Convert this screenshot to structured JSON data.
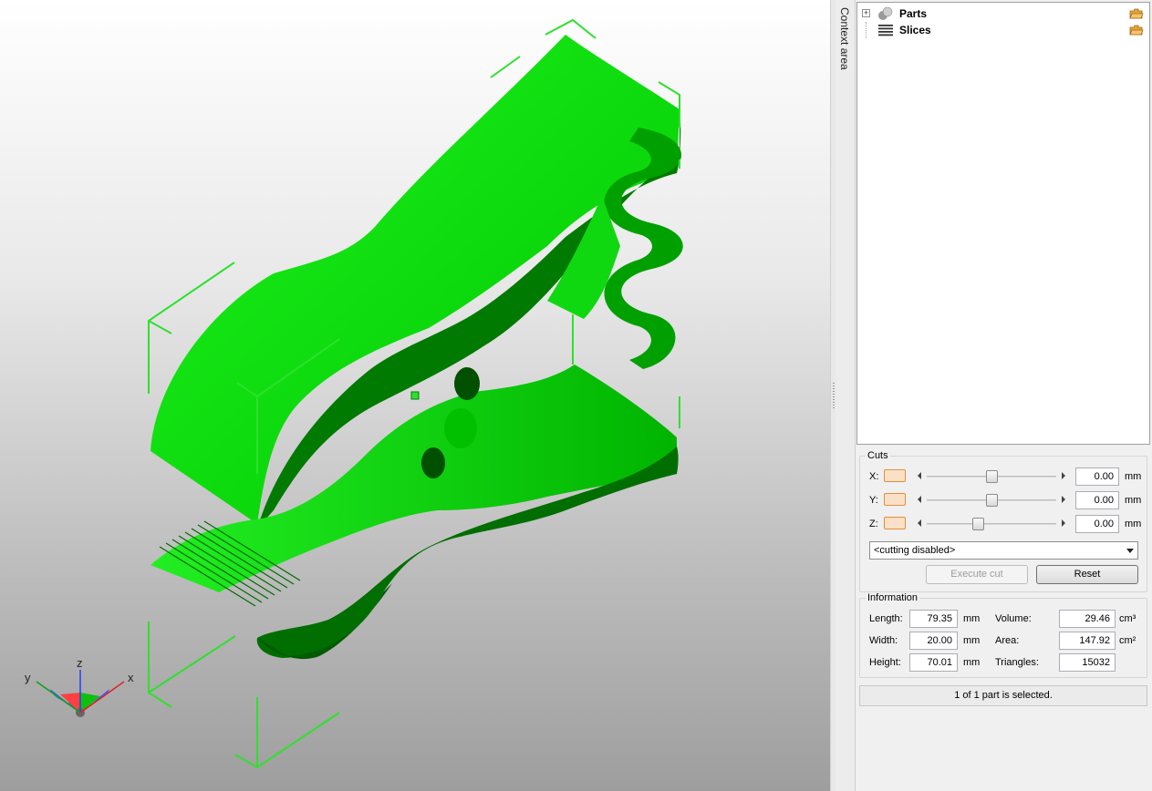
{
  "viewport": {
    "model_color": "#00d800",
    "model_shadow_color": "#006400",
    "bbox_color": "#2ee02e",
    "axes": {
      "x": "x",
      "y": "y",
      "z": "z"
    }
  },
  "sidebar": {
    "context_tab": "Context area"
  },
  "tree": {
    "items": [
      {
        "label": "Parts",
        "icon": "parts-icon"
      },
      {
        "label": "Slices",
        "icon": "slices-icon"
      }
    ]
  },
  "cuts": {
    "title": "Cuts",
    "rows": [
      {
        "axis": "X:",
        "value": "0.00",
        "unit": "mm",
        "slider_fraction": 0.5
      },
      {
        "axis": "Y:",
        "value": "0.00",
        "unit": "mm",
        "slider_fraction": 0.5
      },
      {
        "axis": "Z:",
        "value": "0.00",
        "unit": "mm",
        "slider_fraction": 0.39
      }
    ],
    "mode": "<cutting disabled>",
    "execute_label": "Execute cut",
    "reset_label": "Reset"
  },
  "information": {
    "title": "Information",
    "length_label": "Length:",
    "length": "79.35",
    "length_unit": "mm",
    "width_label": "Width:",
    "width": "20.00",
    "width_unit": "mm",
    "height_label": "Height:",
    "height": "70.01",
    "height_unit": "mm",
    "volume_label": "Volume:",
    "volume": "29.46",
    "volume_unit": "cm³",
    "area_label": "Area:",
    "area": "147.92",
    "area_unit": "cm²",
    "triangles_label": "Triangles:",
    "triangles": "15032"
  },
  "status": "1 of 1 part is selected."
}
